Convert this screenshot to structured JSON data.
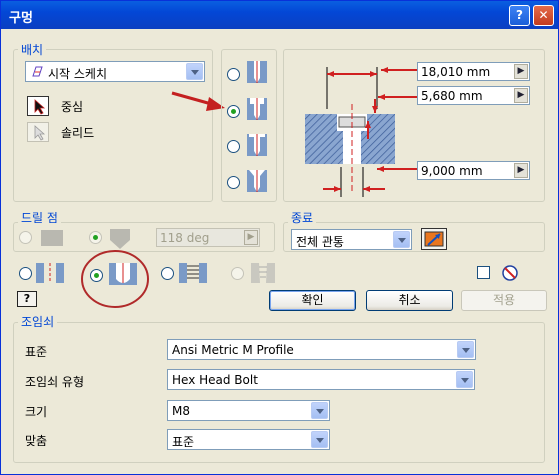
{
  "window": {
    "title": "구멍",
    "help_label": "?",
    "close_label": "✕"
  },
  "placement": {
    "group_label": "배치",
    "sketch_combo": "시작 스케치",
    "center_label": "중심",
    "solid_label": "솔리드"
  },
  "hole_types": {
    "selected_index": 1
  },
  "dimensions": {
    "d1": "18,010 mm",
    "d2": "5,680 mm",
    "d3": "9,000 mm"
  },
  "drill_point": {
    "group_label": "드릴 점",
    "angle": "118 deg"
  },
  "termination": {
    "group_label": "종료",
    "combo": "전체 관통"
  },
  "thread_types": {
    "selected_index": 1
  },
  "buttons": {
    "ok": "확인",
    "cancel": "취소",
    "apply": "적용"
  },
  "fastener": {
    "group_label": "조임쇠",
    "standard_label": "표준",
    "standard_value": "Ansi Metric M Profile",
    "type_label": "조임쇠 유형",
    "type_value": "Hex Head Bolt",
    "size_label": "크기",
    "size_value": "M8",
    "fit_label": "맞춤",
    "fit_value": "표준"
  },
  "colors": {
    "title_bar": "#0347d6",
    "group_label": "#0046d5",
    "annotation": "#c42020"
  }
}
